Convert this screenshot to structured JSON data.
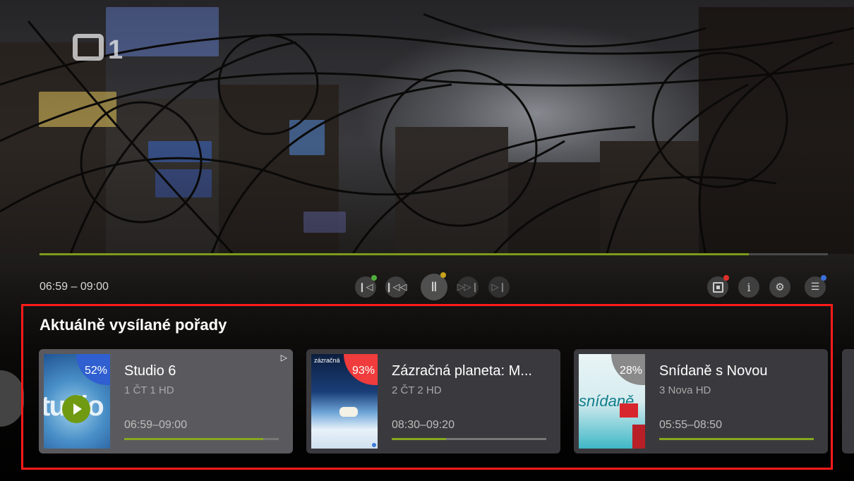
{
  "player": {
    "channel_logo": "1",
    "time_range": "06:59 – 09:00",
    "progress_pct": 90,
    "controls": [
      {
        "name": "skip-previous-button",
        "icon": "skip-previous-icon",
        "glyph": "⏮",
        "dot": "#4fae3a"
      },
      {
        "name": "rewind-button",
        "icon": "rewind-icon",
        "glyph": "⏪",
        "dot": null
      },
      {
        "name": "pause-button",
        "icon": "pause-icon",
        "glyph": "❚❚",
        "dot": "#c9a21b"
      },
      {
        "name": "fast-forward-button",
        "icon": "fast-forward-icon",
        "glyph": "⏩",
        "dot": null
      },
      {
        "name": "skip-next-button",
        "icon": "skip-next-icon",
        "glyph": "⏭",
        "dot": null
      }
    ],
    "right_controls": [
      {
        "name": "record-button",
        "icon": "record-icon",
        "glyph": "⊡",
        "dot": "#e0302a"
      },
      {
        "name": "info-button",
        "icon": "info-icon",
        "glyph": "i",
        "dot": null
      },
      {
        "name": "settings-button",
        "icon": "gear-icon",
        "glyph": "⚙",
        "dot": null
      },
      {
        "name": "menu-button",
        "icon": "menu-icon",
        "glyph": "☰",
        "dot": "#3a6fd8"
      }
    ]
  },
  "onair": {
    "title": "Aktuálně vysílané pořady",
    "cards": [
      {
        "percent": "52%",
        "percent_color": "#2f5fd0",
        "title": "Studio 6",
        "channel": "1 ČT 1 HD",
        "time": "06:59–09:00",
        "progress": 0.9,
        "active": true
      },
      {
        "percent": "93%",
        "percent_color": "#f03c3c",
        "title": "Zázračná planeta: M...",
        "channel": "2 ČT 2 HD",
        "time": "08:30–09:20",
        "progress": 0.35,
        "active": false
      },
      {
        "percent": "28%",
        "percent_color": "#8a8a8a",
        "title": "Snídaně s Novou",
        "channel": "3 Nova HD",
        "time": "05:55–08:50",
        "progress": 1.0,
        "active": false
      }
    ]
  },
  "colors": {
    "accent_green": "#7d9b1c",
    "highlight_border": "#ff1a1a"
  }
}
